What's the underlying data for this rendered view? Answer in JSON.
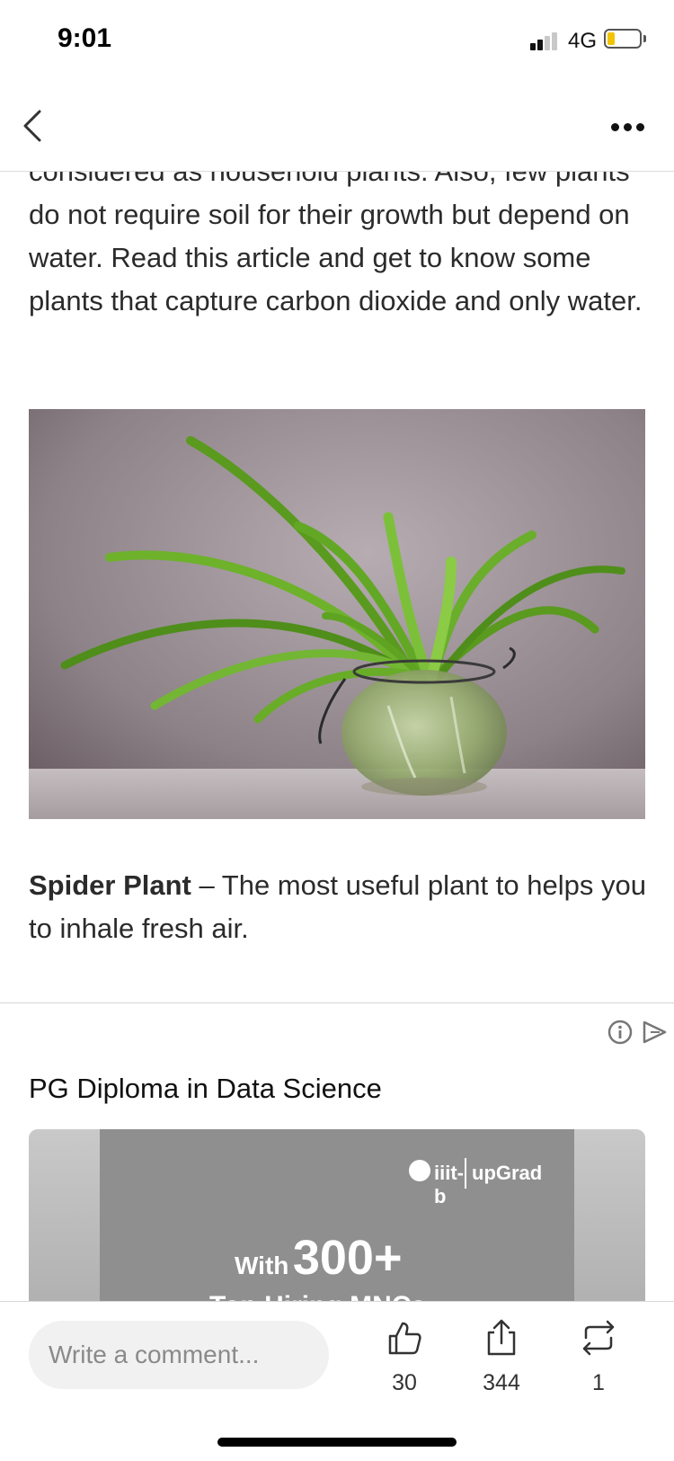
{
  "status_bar": {
    "time": "9:01",
    "network": "4G",
    "signal_bars_active": 2,
    "battery_color": "#f2c300"
  },
  "nav": {
    "back_icon": "chevron-left-icon",
    "more_icon": "more-horizontal-icon"
  },
  "article": {
    "intro": "considered as household plants. Also, few plants do not require soil for their growth but depend on water. Read this article and get to know some plants that capture carbon dioxide and only water.",
    "image_icon": "spider-plant-in-glass-jar-photo",
    "caption_bold": "Spider Plant",
    "caption_rest": " – The most useful plant to helps you to inhale fresh air."
  },
  "ad": {
    "info_icon": "info-circle-icon",
    "choices_icon": "ad-choices-icon",
    "title": "PG Diploma in Data Science",
    "banner": {
      "brand_logo": "iiit-b",
      "brand_name": "upGrad",
      "headline_prefix": "With",
      "headline_number": "300+",
      "subline": "Top Hiring MNCs"
    }
  },
  "bottom_bar": {
    "comment_placeholder": "Write a comment...",
    "like_count": "30",
    "share_count": "344",
    "repost_count": "1",
    "like_icon": "thumbs-up-icon",
    "share_icon": "share-icon",
    "repost_icon": "repost-icon"
  }
}
